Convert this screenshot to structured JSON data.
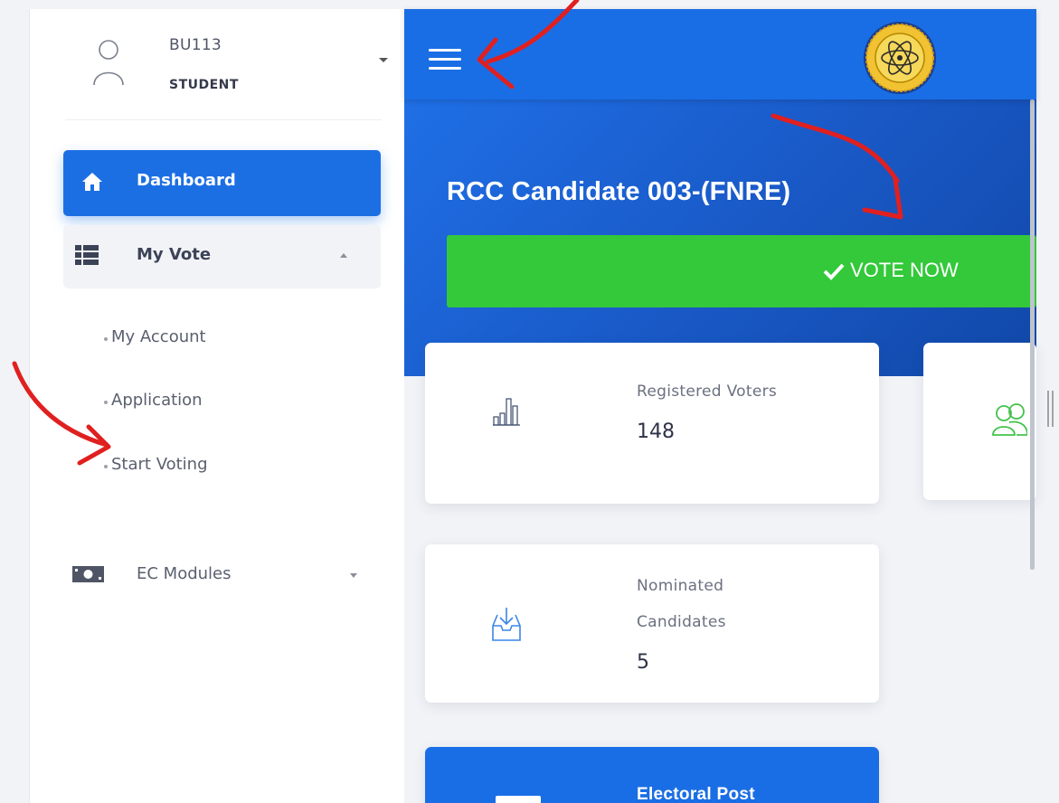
{
  "user": {
    "name": "BU113",
    "role": "STUDENT"
  },
  "sidebar": {
    "dashboard": "Dashboard",
    "my_vote": "My Vote",
    "sub_items": [
      "My Account",
      "Application",
      "Start Voting"
    ],
    "ec_modules": "EC Modules"
  },
  "header": {
    "logo": "atom-seal-logo"
  },
  "hero": {
    "title": "RCC Candidate 003-(FNRE)",
    "vote_button": "VOTE NOW"
  },
  "cards": [
    {
      "label": "Registered Voters",
      "value": "148",
      "icon": "bar-chart-icon"
    },
    {
      "label_line1": "Nominated",
      "label_line2": "Candidates",
      "value": "5",
      "icon": "inbox-download-icon"
    },
    {
      "label": "Electoral Post",
      "icon": "document-icon"
    },
    {
      "icon": "users-icon"
    }
  ],
  "colors": {
    "primary": "#1a6ee5",
    "success": "#33c93a",
    "annotation": "#e02020"
  }
}
